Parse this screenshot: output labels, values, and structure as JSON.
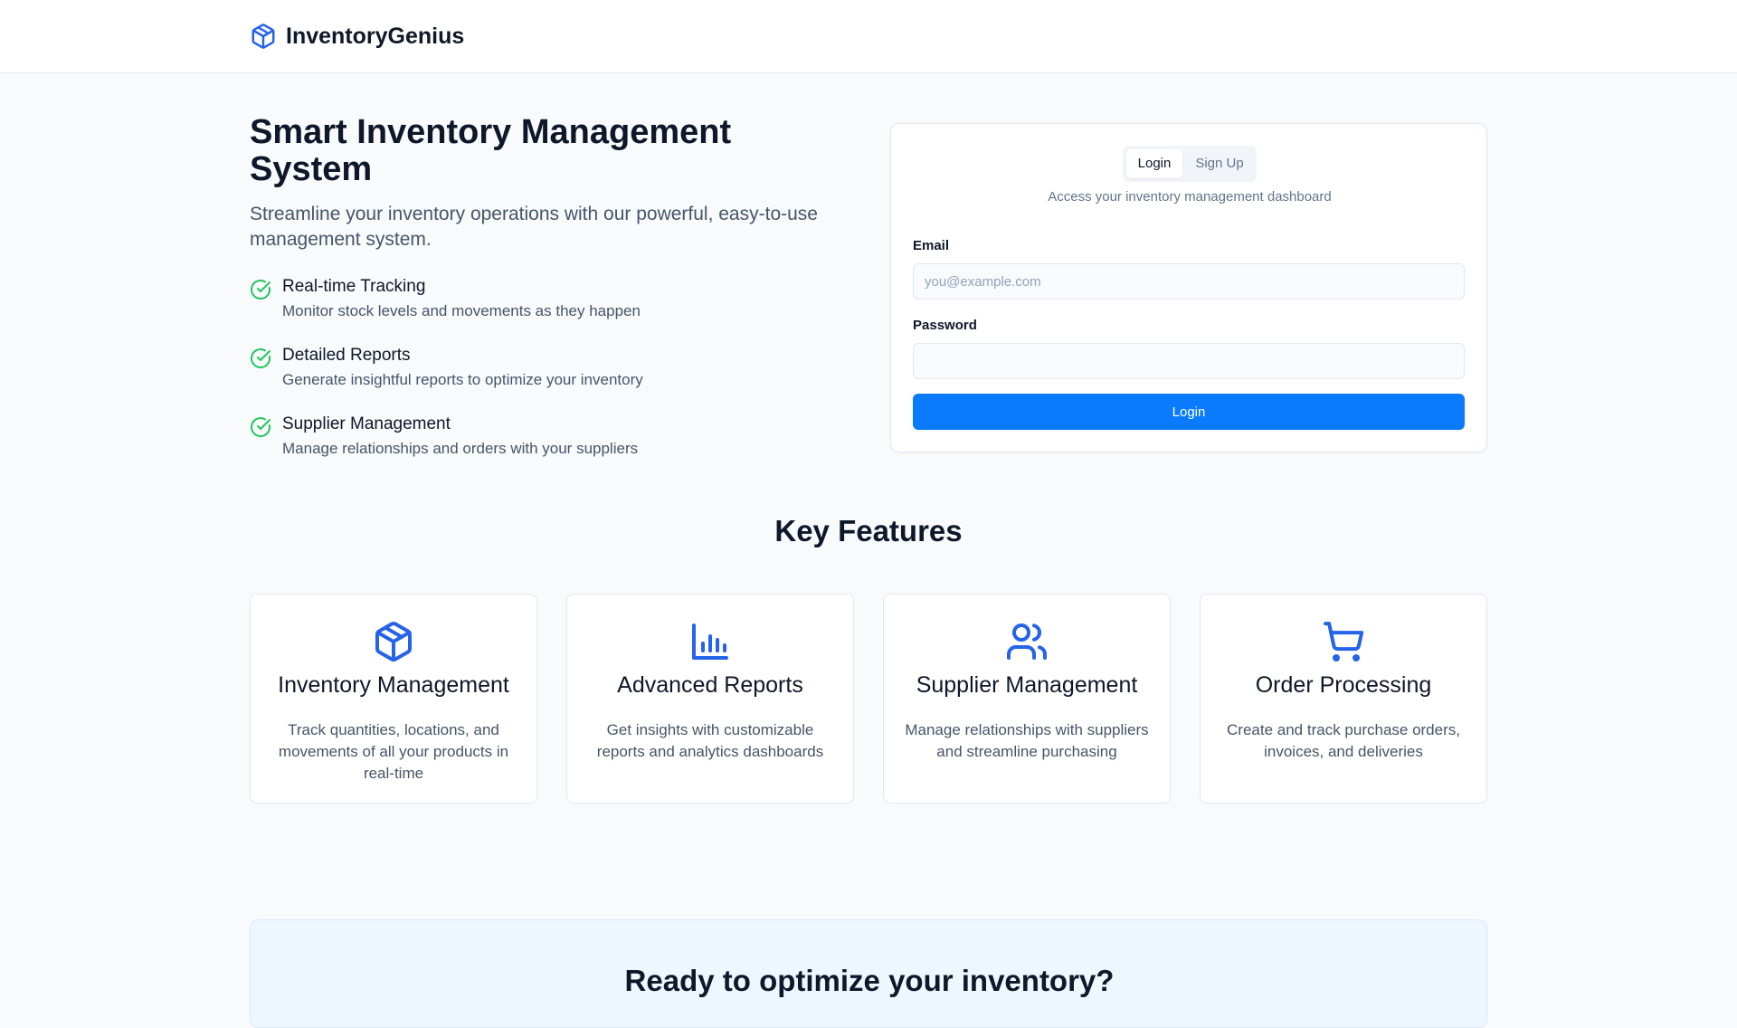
{
  "header": {
    "brand": "InventoryGenius",
    "logo_icon": "package-icon",
    "accent": "#2563eb"
  },
  "hero": {
    "title": "Smart Inventory Management System",
    "subtitle": "Streamline your inventory operations with our powerful, easy-to-use management system.",
    "features": [
      {
        "title": "Real-time Tracking",
        "desc": "Monitor stock levels and movements as they happen",
        "icon": "check-circle-icon"
      },
      {
        "title": "Detailed Reports",
        "desc": "Generate insightful reports to optimize your inventory",
        "icon": "check-circle-icon"
      },
      {
        "title": "Supplier Management",
        "desc": "Manage relationships and orders with your suppliers",
        "icon": "check-circle-icon"
      }
    ],
    "check_color": "#22c55e"
  },
  "auth": {
    "tabs": [
      {
        "label": "Login",
        "active": true
      },
      {
        "label": "Sign Up",
        "active": false
      }
    ],
    "description": "Access your inventory management dashboard",
    "email_label": "Email",
    "email_placeholder": "you@example.com",
    "email_value": "",
    "password_label": "Password",
    "password_value": "",
    "submit_label": "Login",
    "button_color": "#0a7bff"
  },
  "key_features": {
    "title": "Key Features",
    "cards": [
      {
        "icon": "package-icon",
        "title": "Inventory Management",
        "desc": "Track quantities, locations, and movements of all your products in real-time"
      },
      {
        "icon": "bar-chart-icon",
        "title": "Advanced Reports",
        "desc": "Get insights with customizable reports and analytics dashboards"
      },
      {
        "icon": "users-icon",
        "title": "Supplier Management",
        "desc": "Manage relationships with suppliers and streamline purchasing"
      },
      {
        "icon": "shopping-cart-icon",
        "title": "Order Processing",
        "desc": "Create and track purchase orders, invoices, and deliveries"
      }
    ]
  },
  "cta": {
    "title": "Ready to optimize your inventory?"
  }
}
